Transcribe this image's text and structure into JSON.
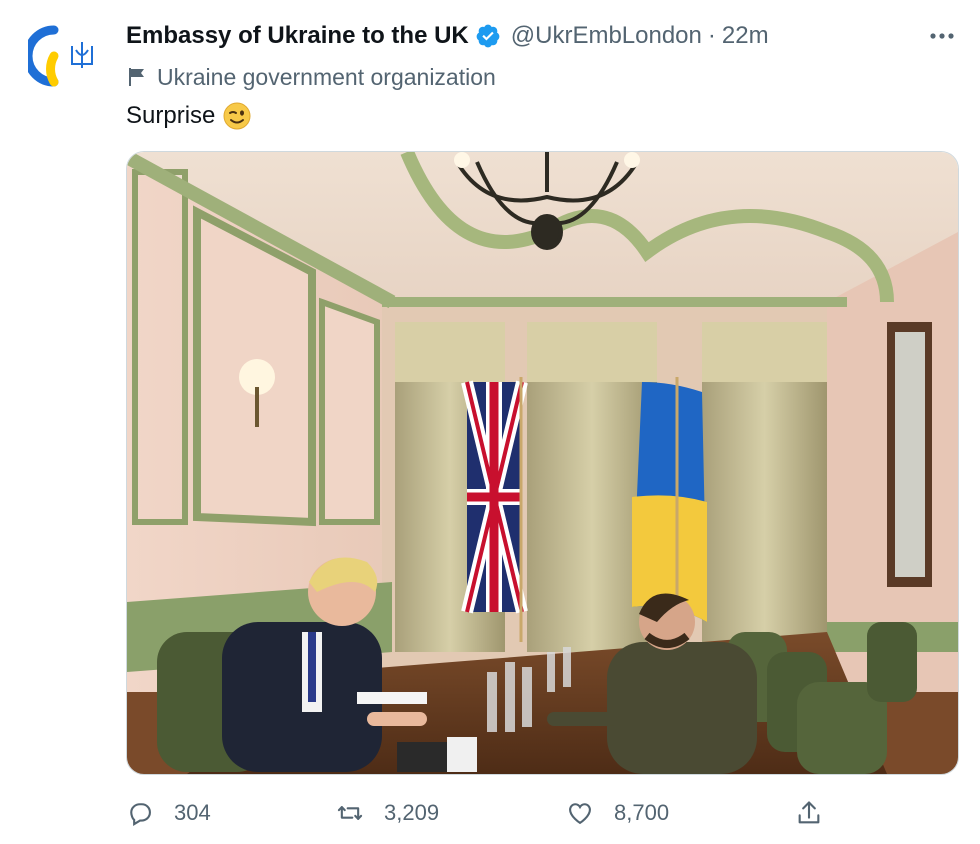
{
  "account": {
    "name": "Embassy of Ukraine to the UK",
    "handle": "@UkrEmbLondon",
    "separator": "·",
    "time": "22m",
    "label": "Ukraine government organization"
  },
  "tweet": {
    "text": "Surprise",
    "emoji": "winking-face"
  },
  "actions": {
    "replies": "304",
    "retweets": "3,209",
    "likes": "8,700"
  },
  "colors": {
    "accent": "#1d9bf0",
    "text": "#0f1419",
    "secondary": "#536471",
    "ukraine_blue": "#0057b7",
    "ukraine_yellow": "#ffd700"
  }
}
